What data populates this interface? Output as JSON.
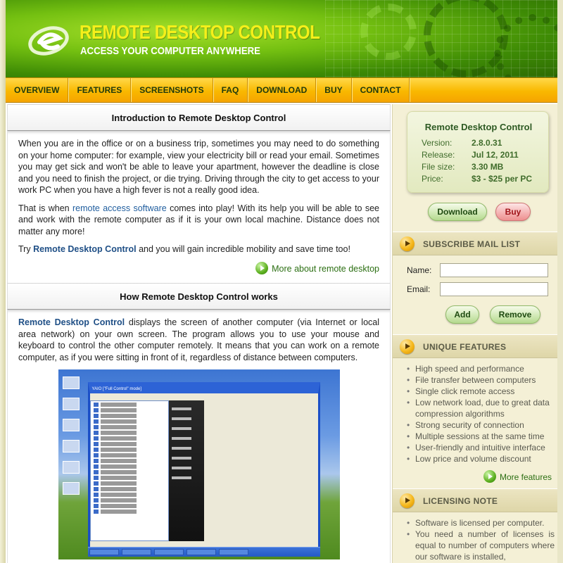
{
  "header": {
    "title": "REMOTE DESKTOP CONTROL",
    "tagline": "ACCESS YOUR COMPUTER ANYWHERE",
    "logo_icon": "e-swoosh-logo-icon"
  },
  "nav": {
    "items": [
      "OVERVIEW",
      "FEATURES",
      "SCREENSHOTS",
      "FAQ",
      "DOWNLOAD",
      "BUY",
      "CONTACT"
    ]
  },
  "intro": {
    "title": "Introduction to Remote Desktop Control",
    "p1": "When you are in the office or on a business trip, sometimes you may need to do something on your home computer: for example, view your electricity bill or read your email. Sometimes you may get sick and won't be able to leave your apartment, however the deadline is close and you need to finish the project, or die trying. Driving through the city to get access to your work PC when you have a high fever is not a really good idea.",
    "p2_before": "That is when ",
    "p2_link": "remote access software",
    "p2_after": " comes into play! With its help you will be able to see and work with the remote computer as if it is your own local machine. Distance does not matter any more!",
    "p3_before": "Try ",
    "p3_link": "Remote Desktop Control",
    "p3_after": " and you will gain incredible mobility and save time too!",
    "more_link": "More about remote desktop"
  },
  "how": {
    "title": "How Remote Desktop Control works",
    "p1_link": "Remote Desktop Control",
    "p1_after": " displays the screen of another computer (via Internet or local area network) on your own screen. The program allows you to use your mouse and keyboard to control the other computer remotely. It means that you can work on a remote computer, as if you were sitting in front of it, regardless of distance between computers.",
    "screenshot_window_title": "YAIO [\"Full Control\" mode]"
  },
  "product": {
    "name": "Remote Desktop Control",
    "rows": [
      {
        "label": "Version:",
        "value": "2.8.0.31"
      },
      {
        "label": "Release:",
        "value": "Jul 12, 2011"
      },
      {
        "label": "File size:",
        "value": "3.30 MB"
      },
      {
        "label": "Price:",
        "value": "$3 - $25 per PC"
      }
    ],
    "download_label": "Download",
    "buy_label": "Buy"
  },
  "subscribe": {
    "title": "SUBSCRIBE MAIL LIST",
    "name_label": "Name:",
    "email_label": "Email:",
    "name_value": "",
    "email_value": "",
    "add_label": "Add",
    "remove_label": "Remove"
  },
  "features": {
    "title": "UNIQUE FEATURES",
    "items": [
      "High speed and performance",
      "File transfer between computers",
      "Single click remote access",
      "Low network load, due to great data compression algorithms",
      "Strong security of connection",
      "Multiple sessions at the same time",
      "User-friendly and intuitive interface",
      "Low price and volume discount"
    ],
    "more_label": "More features"
  },
  "licensing": {
    "title": "LICENSING NOTE",
    "items": [
      "Software is licensed per computer.",
      "You need a number of licenses is equal to number of computers where our software is installed,"
    ]
  }
}
